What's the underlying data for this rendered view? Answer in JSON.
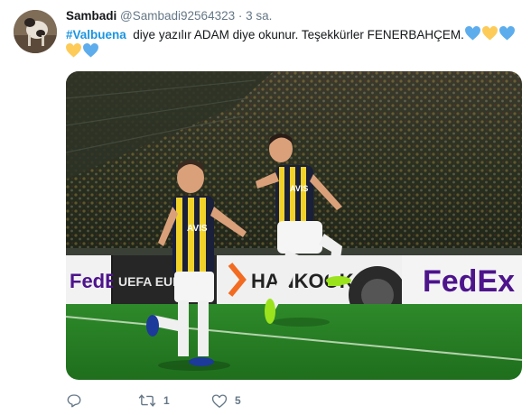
{
  "tweet": {
    "author_name": "Sambadi",
    "author_handle": "@Sambadi92564323",
    "separator": "·",
    "time": "3 sa.",
    "hashtag": "#Valbuena",
    "text": "  diye yazılır ADAM diye okunur. Teşekkürler FENERBAHÇEM.",
    "emojis": [
      "blue-heart",
      "yellow-heart",
      "blue-heart",
      "yellow-heart",
      "blue-heart"
    ],
    "colors": {
      "blue_heart": "#5dadec",
      "yellow_heart": "#fdcb58",
      "hashtag": "#1b95e0"
    },
    "media": {
      "board_texts": [
        "FedEx",
        "UEFA EUROPA",
        "HANKOOK",
        "FedEx"
      ],
      "jersey_texts": [
        "AVIS",
        "AVIS"
      ]
    },
    "actions": {
      "reply_count": "",
      "retweet_count": "1",
      "like_count": "5"
    }
  }
}
